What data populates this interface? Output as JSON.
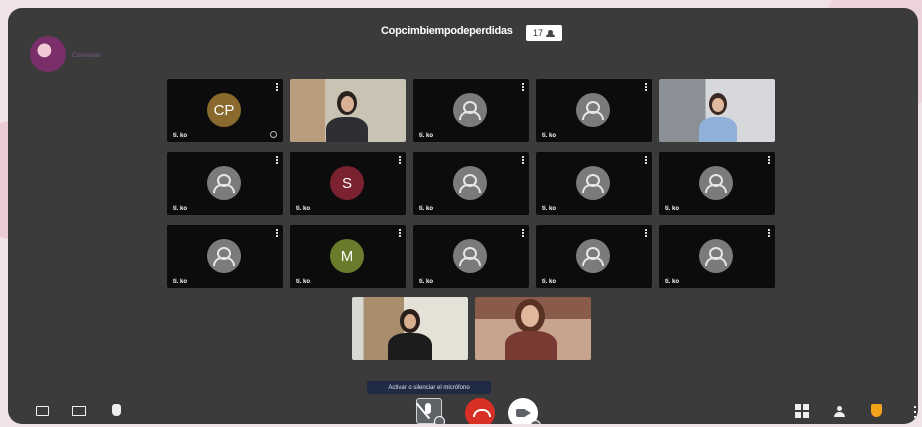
{
  "meeting": {
    "title": "Copcimbiempodeperdidas",
    "participant_count": "17"
  },
  "branding": {
    "logo_text": "Conversan"
  },
  "tiles": [
    {
      "initials": "CP",
      "avatar_color": "#8a6a2c",
      "name": "ti. ko"
    },
    {
      "initials": "",
      "video": true,
      "name": ""
    },
    {
      "initials": "",
      "name": "ti. ko"
    },
    {
      "initials": "",
      "name": "ti. ko"
    },
    {
      "initials": "",
      "video": true,
      "name": ""
    },
    {
      "initials": "",
      "name": "ti. ko"
    },
    {
      "initials": "S",
      "avatar_color": "#7a2230",
      "name": "ti. ko"
    },
    {
      "initials": "",
      "name": "ti. ko"
    },
    {
      "initials": "",
      "name": "ti. ko"
    },
    {
      "initials": "",
      "name": "ti. ko"
    },
    {
      "initials": "",
      "name": "ti. ko"
    },
    {
      "initials": "M",
      "avatar_color": "#6b7b2c",
      "name": "ti. ko"
    },
    {
      "initials": "",
      "name": "ti. ko"
    },
    {
      "initials": "",
      "name": "ti. ko"
    },
    {
      "initials": "",
      "name": "ti. ko"
    },
    {
      "initials": "",
      "video": true,
      "name": ""
    },
    {
      "initials": "",
      "video": true,
      "name": ""
    }
  ],
  "tooltip": "Activar o silenciar el micrófono",
  "icons": {
    "chat": "chat-icon",
    "present": "present-screen-icon",
    "hand": "raise-hand-icon",
    "mic": "mic-off-icon",
    "end": "end-call-icon",
    "camera": "camera-icon",
    "layout": "grid-layout-icon",
    "people": "people-icon",
    "security": "shield-icon",
    "more": "more-vert-icon"
  },
  "colors": {
    "end_call": "#d93025",
    "security": "#f4a21a",
    "window_bg": "#3b3b3b"
  }
}
